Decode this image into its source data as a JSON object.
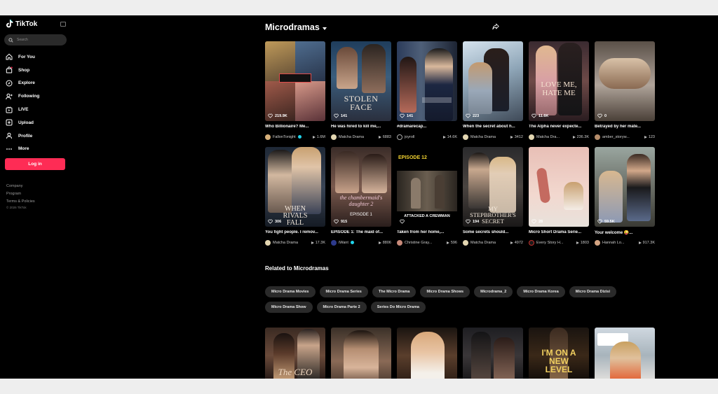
{
  "sidebar": {
    "brand": "TikTok",
    "search_placeholder": "Search",
    "nav": [
      {
        "label": "For You",
        "icon": "home-icon"
      },
      {
        "label": "Shop",
        "icon": "shop-icon"
      },
      {
        "label": "Explore",
        "icon": "compass-icon"
      },
      {
        "label": "Following",
        "icon": "following-icon"
      },
      {
        "label": "LIVE",
        "icon": "live-icon"
      },
      {
        "label": "Upload",
        "icon": "upload-icon"
      },
      {
        "label": "Profile",
        "icon": "profile-icon"
      },
      {
        "label": "More",
        "icon": "more-icon"
      }
    ],
    "login": "Log in",
    "footer": [
      "Company",
      "Program",
      "Terms & Policies"
    ],
    "copyright": "© 2026 TikTok"
  },
  "main": {
    "title": "Microdramas",
    "videos": [
      {
        "views": "219.9K",
        "caption": "Who Billionaire? Me...",
        "author": "FallonTonight",
        "verified": true,
        "plays": "1.6M",
        "thumb_text": ""
      },
      {
        "views": "141",
        "caption": "He was hired to kill me,...",
        "author": "Matcha Drama",
        "verified": false,
        "plays": "6883",
        "thumb_text": "STOLEN FACE"
      },
      {
        "views": "141",
        "caption": "#dramarecap...",
        "author": "joyroll",
        "verified": false,
        "plays": "14.6K",
        "thumb_text": ""
      },
      {
        "views": "223",
        "caption": "When the secret about h...",
        "author": "Matcha Drama",
        "verified": false,
        "plays": "3412",
        "thumb_text": ""
      },
      {
        "views": "11.6K",
        "caption": "The Alpha never expecte...",
        "author": "Matcha Dra...",
        "verified": false,
        "plays": "236.3K",
        "thumb_text": "LOVE ME, HATE ME"
      },
      {
        "views": "0",
        "caption": "Betrayed by her mate...",
        "author": "amber_storyw...",
        "verified": false,
        "plays": "123",
        "thumb_text": ""
      },
      {
        "views": "306",
        "caption": "You fight people. I remov...",
        "author": "Matcha Drama",
        "verified": false,
        "plays": "17.3K",
        "thumb_text": "WHEN RIVALS FALL"
      },
      {
        "views": "915",
        "caption": "EPISODE 1: The maid of...",
        "author": "iWant",
        "verified": true,
        "plays": "8806",
        "thumb_text": "the chambermaid's daughter 2"
      },
      {
        "views": "",
        "caption": "Taken from her home,...",
        "author": "Christine Gray...",
        "verified": false,
        "plays": "596",
        "thumb_text": "ATTACKED A CREWMAN"
      },
      {
        "views": "194",
        "caption": "Some secrets should...",
        "author": "Matcha Drama",
        "verified": false,
        "plays": "4972",
        "thumb_text": "MY STEPBROTHER'S SECRET"
      },
      {
        "views": "28",
        "caption": "Micro Short Drama Serie...",
        "author": "Every Story H...",
        "verified": false,
        "plays": "1803",
        "thumb_text": ""
      },
      {
        "views": "59.5K",
        "caption": "Your welcome 😜...",
        "author": "Hannah Lo...",
        "verified": false,
        "plays": "917.3K",
        "thumb_text": ""
      }
    ],
    "episode_badge": "EPISODE 12",
    "episode_1_label": "EPISODE 1",
    "related_title": "Related to Microdramas",
    "chips": [
      "Micro Drama Movies",
      "Micro Drama Series",
      "The Micro Drama",
      "Micro Drama Shows",
      "Microdrama_2",
      "Micro Drama Korea",
      "Micro Drama Dizisi",
      "Micro Drama Show",
      "Micro Drama Parte 2",
      "Series Do Micro Drama"
    ],
    "bottom_thumb_texts": [
      "The CEO",
      "",
      "",
      "",
      "I'M ON A NEW LEVEL",
      ""
    ]
  },
  "colors": {
    "accent": "#fe2c55",
    "verified": "#20d5ec"
  }
}
